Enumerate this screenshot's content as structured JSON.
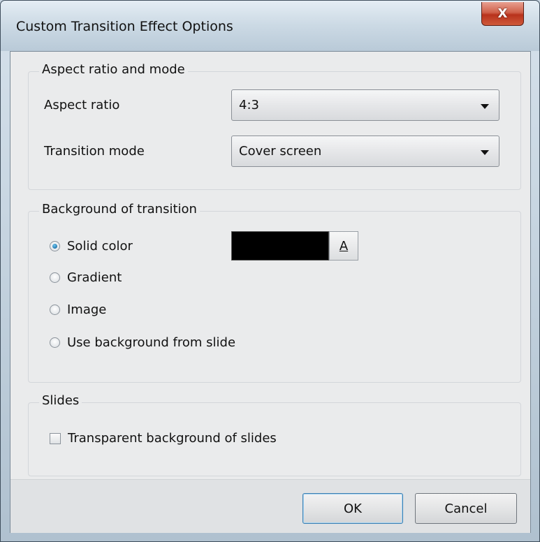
{
  "window": {
    "title": "Custom Transition Effect Options",
    "close_label": "X"
  },
  "aspect_group": {
    "legend": "Aspect ratio and mode",
    "aspect_ratio_label": "Aspect ratio",
    "aspect_ratio_value": "4:3",
    "transition_mode_label": "Transition mode",
    "transition_mode_value": "Cover screen"
  },
  "background_group": {
    "legend": "Background of transition",
    "options": [
      {
        "label": "Solid color",
        "checked": true
      },
      {
        "label": "Gradient",
        "checked": false
      },
      {
        "label": "Image",
        "checked": false
      },
      {
        "label": "Use background from slide",
        "checked": false
      }
    ],
    "color_value": "#000000",
    "color_button_label": "A"
  },
  "slides_group": {
    "legend": "Slides",
    "transparent_label": "Transparent background of slides",
    "transparent_checked": false
  },
  "footer": {
    "ok_label": "OK",
    "cancel_label": "Cancel"
  }
}
